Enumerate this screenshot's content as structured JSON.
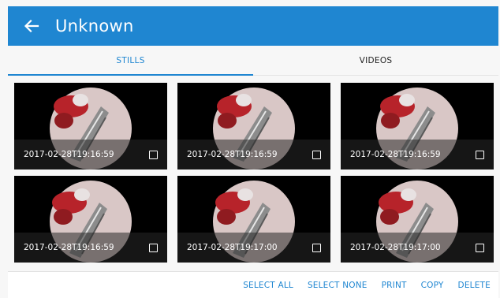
{
  "header": {
    "title": "Unknown",
    "back_icon": "arrow-left-icon",
    "color": "#1f86d1"
  },
  "tabs": [
    {
      "label": "STILLS",
      "active": true
    },
    {
      "label": "VIDEOS",
      "active": false
    }
  ],
  "stills": [
    {
      "timestamp": "2017-02-28T19:16:59",
      "checked": false
    },
    {
      "timestamp": "2017-02-28T19:16:59",
      "checked": false
    },
    {
      "timestamp": "2017-02-28T19:16:59",
      "checked": false
    },
    {
      "timestamp": "2017-02-28T19:16:59",
      "checked": false
    },
    {
      "timestamp": "2017-02-28T19:17:00",
      "checked": false
    },
    {
      "timestamp": "2017-02-28T19:17:00",
      "checked": false
    }
  ],
  "actions": {
    "select_all": "SELECT ALL",
    "select_none": "SELECT NONE",
    "print": "PRINT",
    "copy": "COPY",
    "delete": "DELETE"
  },
  "colors": {
    "accent": "#1f86d1",
    "background": "#f7f7f7"
  }
}
